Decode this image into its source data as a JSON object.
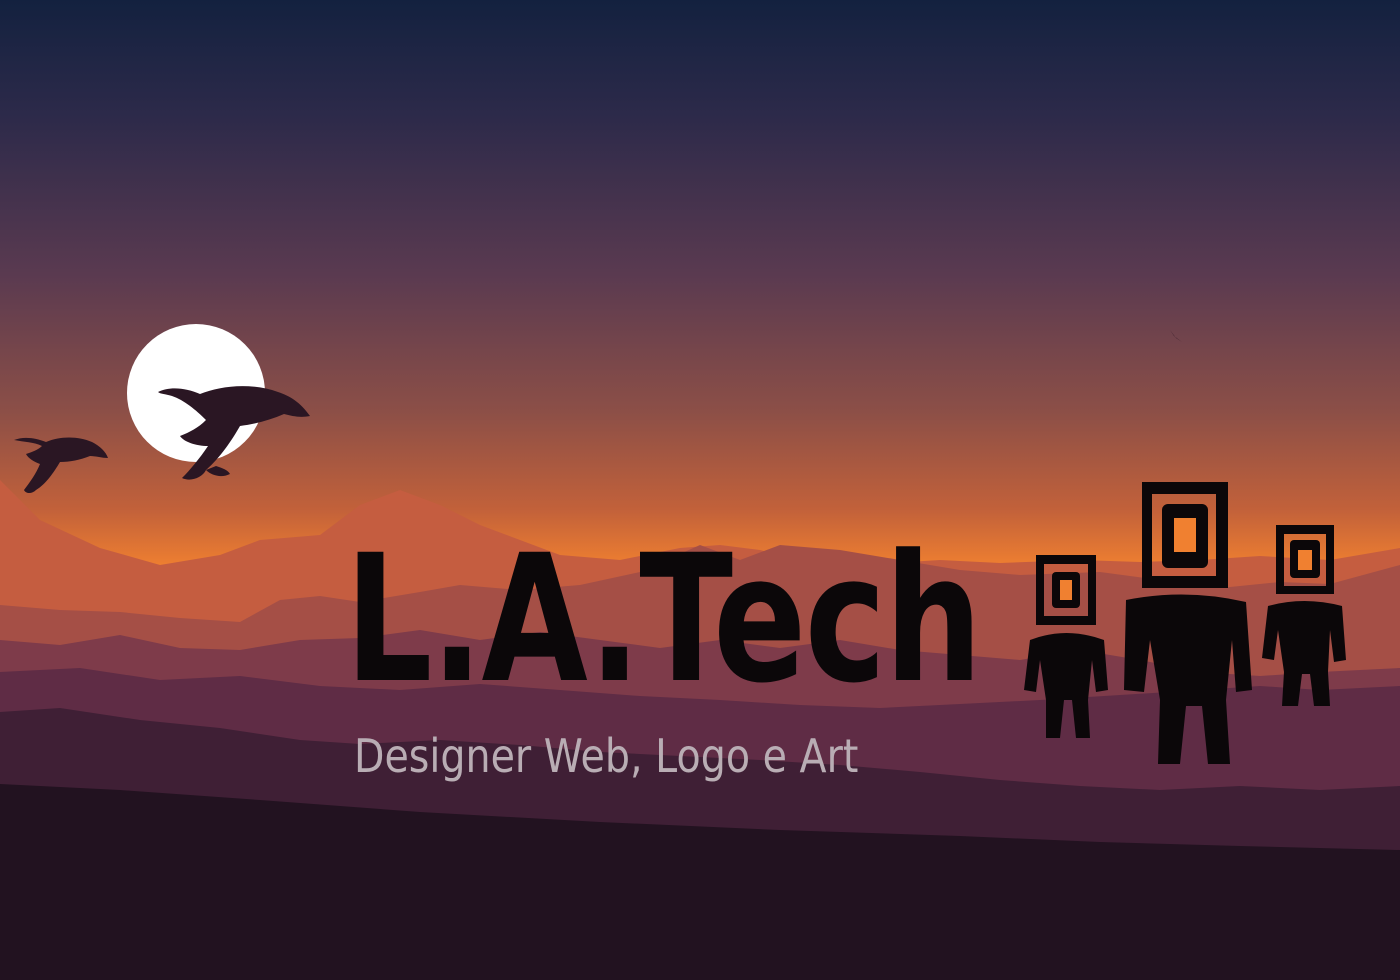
{
  "brand": {
    "name": "L.A.Tech",
    "tagline": "Designer Web, Logo e Art"
  },
  "colors": {
    "sky_top": "#13213f",
    "sky_middle": "#7d4b4f",
    "sky_horizon": "#f5852a",
    "moon": "#ffffff",
    "silhouette": "#0b0709",
    "tagline": "#b9adb4",
    "ground": "#221220"
  },
  "icons": {
    "birds": "flying-goose-icon",
    "mascots": "square-head-figure-icon"
  }
}
